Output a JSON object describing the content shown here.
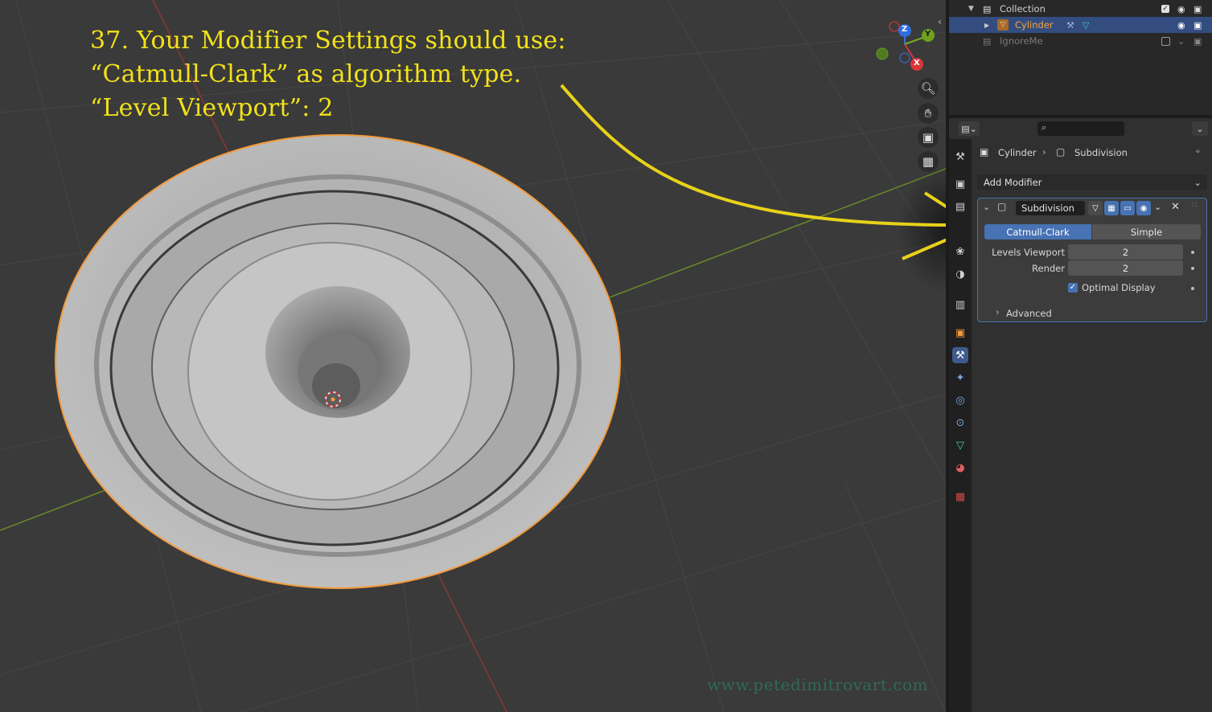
{
  "caption": {
    "line1": "37. Your Modifier Settings should use:",
    "line2": "“Catmull-Clark” as algorithm type.",
    "line3": "“Level Viewport”: 2"
  },
  "gizmo": {
    "z": "Z",
    "y": "Y",
    "x": "X"
  },
  "outliner": {
    "collection": "Collection",
    "cylinder": "Cylinder",
    "ignore": "IgnoreMe"
  },
  "props": {
    "breadcrumb_object": "Cylinder",
    "breadcrumb_modifier": "Subdivision",
    "add_modifier": "Add Modifier",
    "modifier_name": "Subdivision",
    "algo_catmull": "Catmull-Clark",
    "algo_simple": "Simple",
    "levels_viewport_label": "Levels Viewport",
    "levels_viewport_value": "2",
    "render_label": "Render",
    "render_value": "2",
    "optimal_display_label": "Optimal Display",
    "advanced_label": "Advanced"
  },
  "watermark": "www.petedimitrovart.com",
  "colors": {
    "selection": "#f29a3a",
    "accent": "#4772b3",
    "caption": "#f2e21a"
  }
}
